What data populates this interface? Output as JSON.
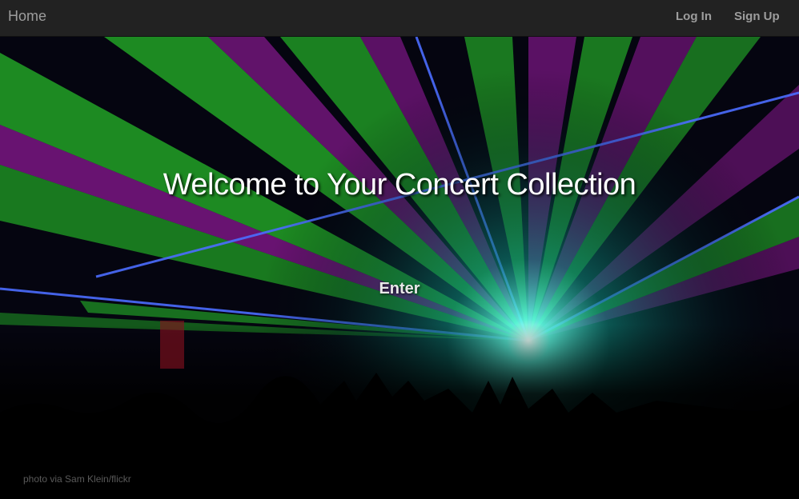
{
  "navbar": {
    "brand": "Home",
    "links": [
      {
        "label": "Log In"
      },
      {
        "label": "Sign Up"
      }
    ]
  },
  "hero": {
    "title": "Welcome to Your Concert Collection",
    "enter_label": "Enter",
    "credit": "photo via Sam Klein/flickr"
  },
  "colors": {
    "navbar_bg": "#222222",
    "nav_text": "#9d9d9d",
    "laser_green": "#39ff3a",
    "laser_magenta": "#c020c8",
    "laser_blue": "#3a5bff",
    "laser_cyan": "#3fffe0"
  }
}
